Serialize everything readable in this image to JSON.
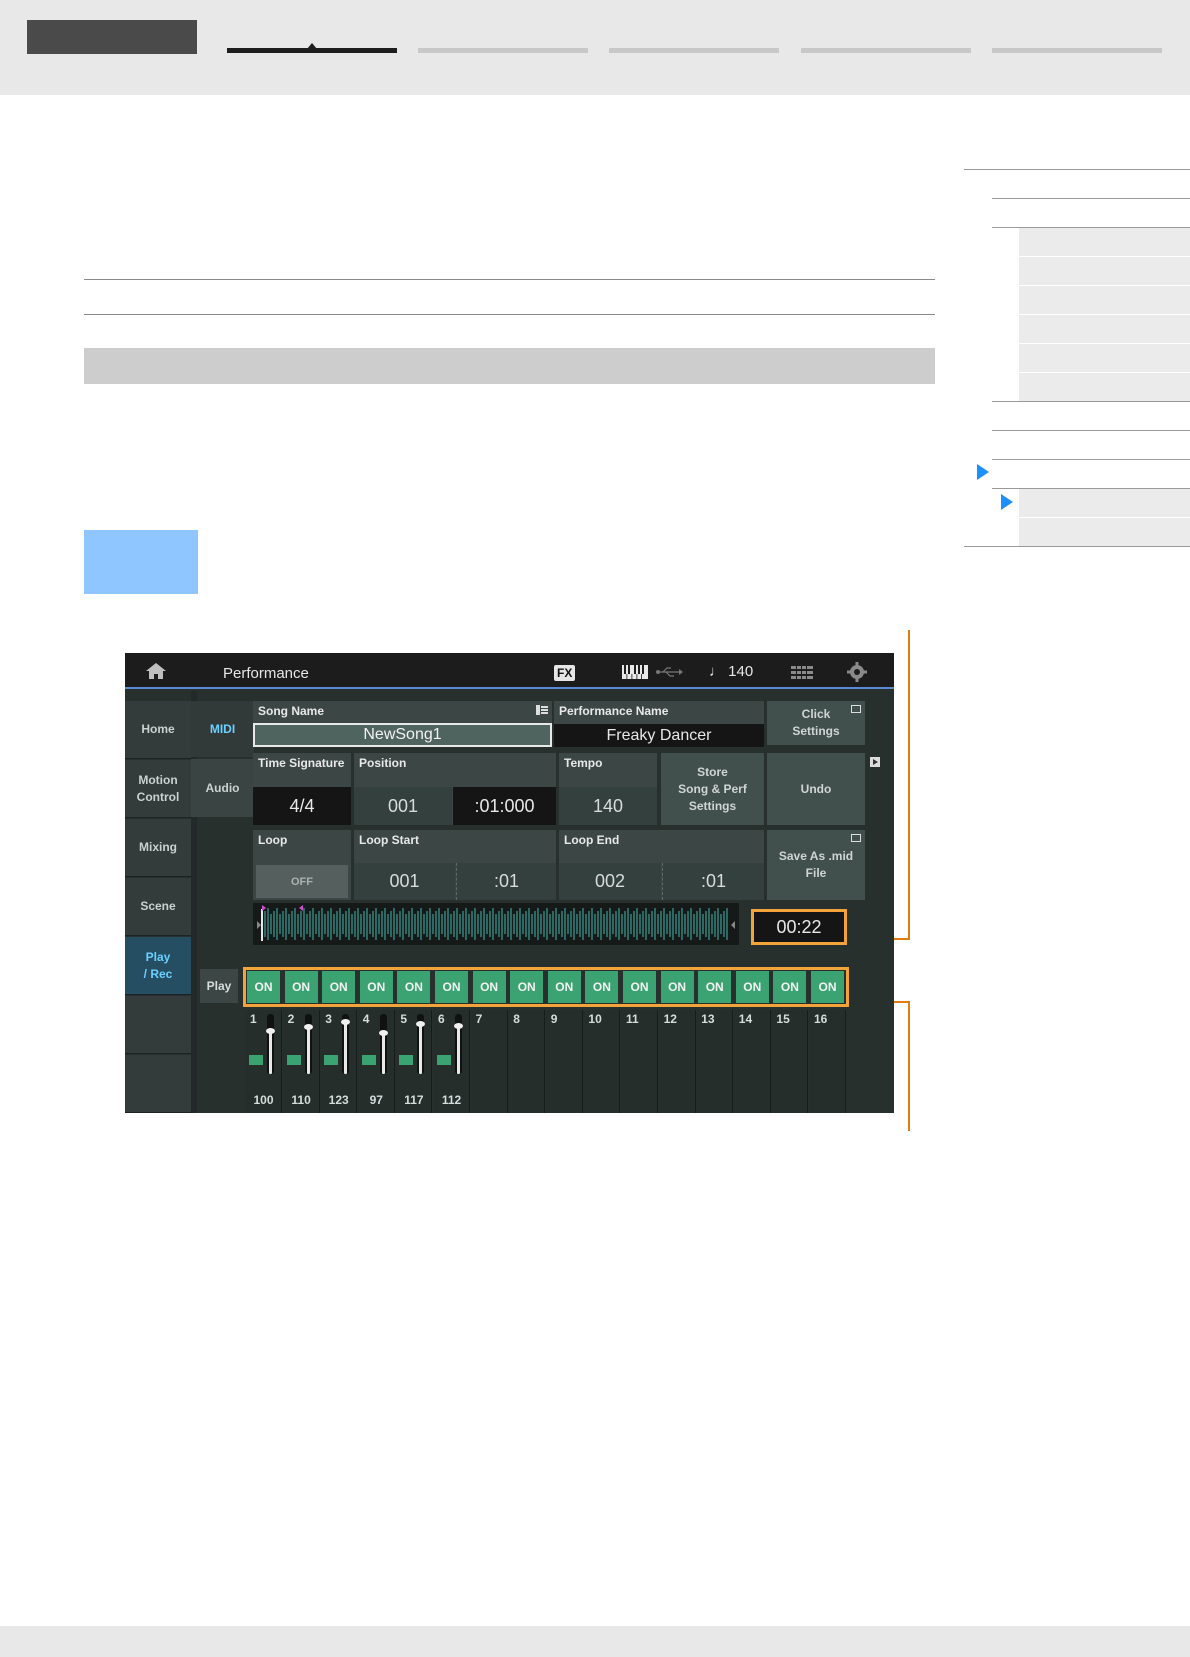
{
  "screen": {
    "title": "Performance",
    "fx_badge": "FX",
    "tempo_display": "♩ 140",
    "side_tabs": [
      {
        "label": "Home",
        "active": false
      },
      {
        "label": "Motion\nControl",
        "active": false
      },
      {
        "label": "Mixing",
        "active": false
      },
      {
        "label": "Scene",
        "active": false
      },
      {
        "label": "Play\n/ Rec",
        "active": true
      }
    ],
    "sub_tabs": [
      {
        "label": "MIDI",
        "active": true
      },
      {
        "label": "Audio",
        "active": false
      }
    ],
    "song_name": {
      "label": "Song Name",
      "value": "NewSong1"
    },
    "performance_name": {
      "label": "Performance Name",
      "value": "Freaky Dancer"
    },
    "click_settings": "Click\nSettings",
    "time_signature": {
      "label": "Time Signature",
      "value": "4/4"
    },
    "position": {
      "label": "Position",
      "measure": "001",
      "beat_clock": ":01:000"
    },
    "tempo": {
      "label": "Tempo",
      "value": "140"
    },
    "store_button": "Store\nSong & Perf\nSettings",
    "undo_button": "Undo",
    "loop": {
      "label": "Loop",
      "value": "OFF"
    },
    "loop_start": {
      "label": "Loop Start",
      "measure": "001",
      "beat": ":01"
    },
    "loop_end": {
      "label": "Loop End",
      "measure": "002",
      "beat": ":01"
    },
    "save_mid_button": "Save As .mid\nFile",
    "elapsed_time": "00:22",
    "play_label": "Play",
    "tracks": [
      {
        "num": "1",
        "on": "ON",
        "volume": "100",
        "level": 100
      },
      {
        "num": "2",
        "on": "ON",
        "volume": "110",
        "level": 110
      },
      {
        "num": "3",
        "on": "ON",
        "volume": "123",
        "level": 123
      },
      {
        "num": "4",
        "on": "ON",
        "volume": "97",
        "level": 97
      },
      {
        "num": "5",
        "on": "ON",
        "volume": "117",
        "level": 117
      },
      {
        "num": "6",
        "on": "ON",
        "volume": "112",
        "level": 112
      },
      {
        "num": "7",
        "on": "ON",
        "volume": "",
        "level": null
      },
      {
        "num": "8",
        "on": "ON",
        "volume": "",
        "level": null
      },
      {
        "num": "9",
        "on": "ON",
        "volume": "",
        "level": null
      },
      {
        "num": "10",
        "on": "ON",
        "volume": "",
        "level": null
      },
      {
        "num": "11",
        "on": "ON",
        "volume": "",
        "level": null
      },
      {
        "num": "12",
        "on": "ON",
        "volume": "",
        "level": null
      },
      {
        "num": "13",
        "on": "ON",
        "volume": "",
        "level": null
      },
      {
        "num": "14",
        "on": "ON",
        "volume": "",
        "level": null
      },
      {
        "num": "15",
        "on": "ON",
        "volume": "",
        "level": null
      },
      {
        "num": "16",
        "on": "ON",
        "volume": "",
        "level": null
      }
    ]
  },
  "colors": {
    "accent_orange": "#f2a33a",
    "on_green": "#3aa371",
    "active_tab_blue": "#6ad0ff",
    "toc_arrow_blue": "#1e8fff",
    "light_blue_box": "#8fc6ff"
  },
  "icons": [
    "home-icon",
    "keyboard-icon",
    "usb-icon",
    "quarter-note-icon",
    "grid-icon",
    "gear-icon",
    "window-icon",
    "play-icon",
    "toc-arrow-icon"
  ]
}
